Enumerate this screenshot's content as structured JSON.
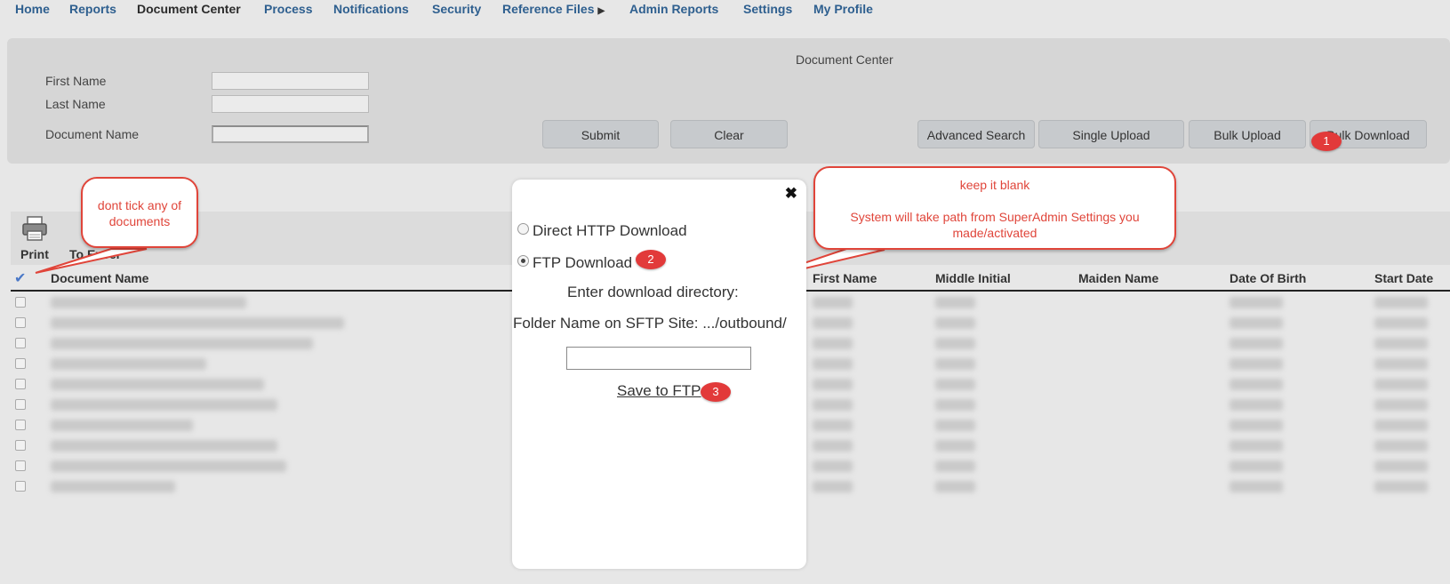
{
  "nav": {
    "items": [
      {
        "label": "Home"
      },
      {
        "label": "Reports"
      },
      {
        "label": "Document Center"
      },
      {
        "label": "Process"
      },
      {
        "label": "Notifications"
      },
      {
        "label": "Security"
      },
      {
        "label": "Reference Files"
      },
      {
        "label": "Admin Reports"
      },
      {
        "label": "Settings"
      },
      {
        "label": "My Profile"
      }
    ],
    "active": "Document Center",
    "reference_caret": "▶"
  },
  "search": {
    "title": "Document Center",
    "first_name_label": "First Name",
    "last_name_label": "Last Name",
    "document_name_label": "Document Name",
    "first_name_value": "",
    "last_name_value": "",
    "document_name_value": "",
    "submit_label": "Submit",
    "clear_label": "Clear",
    "advanced_search_label": "Advanced Search",
    "single_upload_label": "Single Upload",
    "bulk_upload_label": "Bulk Upload",
    "bulk_download_label": "Bulk Download"
  },
  "grid": {
    "print_label": "Print",
    "to_excel_label": "To Excel",
    "check_all_icon": "checkmark-icon",
    "columns": [
      "Document Name",
      "First Name",
      "Middle Initial",
      "Maiden Name",
      "Date Of Birth",
      "Start Date"
    ],
    "row_count": 10
  },
  "modal": {
    "close_glyph": "✖",
    "option_http": "Direct HTTP Download",
    "option_ftp": "FTP Download",
    "selected_option": "FTP Download",
    "enter_dir_label": "Enter download directory:",
    "folder_label": "Folder Name on SFTP Site: .../outbound/",
    "directory_value": "",
    "save_label": "Save to FTP"
  },
  "annotations": {
    "badges": [
      "1",
      "2",
      "3"
    ],
    "callout_checkbox": "dont tick any of documents",
    "callout_blank_line1": "keep it blank",
    "callout_blank_line2": "System will take path from SuperAdmin Settings you made/activated",
    "color": "#e0453a"
  }
}
